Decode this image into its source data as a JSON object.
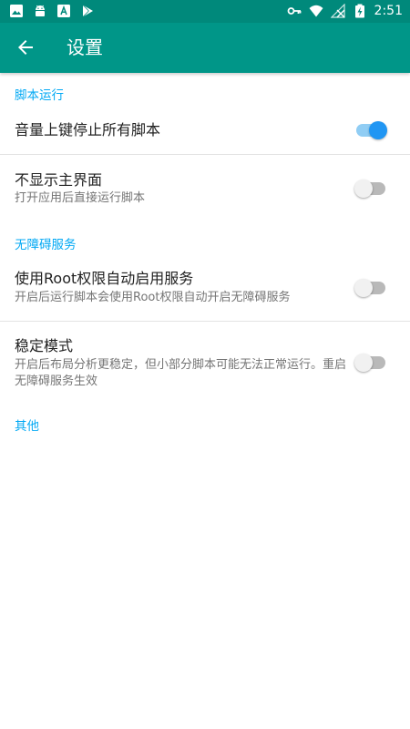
{
  "status_bar": {
    "time": "2:51",
    "left_icons": [
      "image-icon",
      "android-icon",
      "font-icon",
      "play-store-icon"
    ],
    "right_icons": [
      "vpn-key-icon",
      "wifi-icon",
      "no-signal-icon",
      "battery-charging-icon"
    ]
  },
  "app_bar": {
    "title": "设置",
    "back_icon": "arrow-back-icon"
  },
  "sections": [
    {
      "header": "脚本运行",
      "prefs": [
        {
          "title": "音量上键停止所有脚本",
          "summary": "",
          "enabled": true
        },
        {
          "title": "不显示主界面",
          "summary": "打开应用后直接运行脚本",
          "enabled": false
        }
      ]
    },
    {
      "header": "无障碍服务",
      "prefs": [
        {
          "title": "使用Root权限自动启用服务",
          "summary": "开启后运行脚本会使用Root权限自动开启无障碍服务",
          "enabled": false
        },
        {
          "title": "稳定模式",
          "summary": "开启后布局分析更稳定，但小部分脚本可能无法正常运行。重启无障碍服务生效",
          "enabled": false
        }
      ]
    },
    {
      "header": "其他",
      "prefs": []
    }
  ],
  "colors": {
    "status_bar": "#00897b",
    "app_bar": "#009688",
    "accent": "#03a9f4",
    "switch_on": "#2196f3",
    "title_text": "#212121",
    "summary_text": "#757575"
  }
}
